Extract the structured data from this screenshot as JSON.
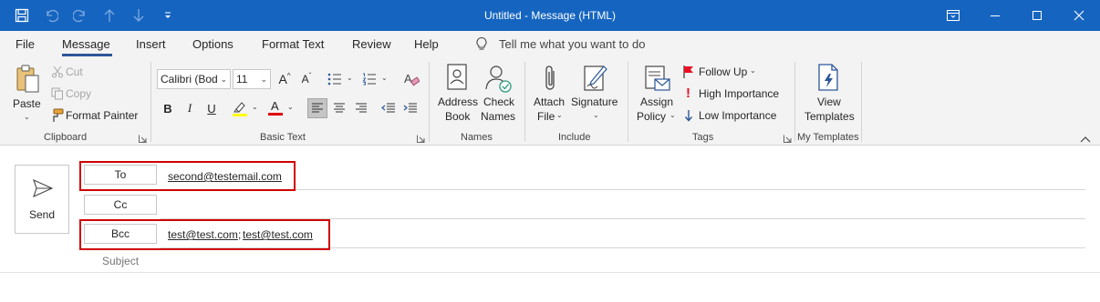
{
  "window": {
    "title": "Untitled  -  Message (HTML)"
  },
  "menu": {
    "tabs": [
      "File",
      "Message",
      "Insert",
      "Options",
      "Format Text",
      "Review",
      "Help"
    ],
    "active_tab": "Message",
    "tell_me": "Tell me what you want to do"
  },
  "ribbon": {
    "clipboard": {
      "paste": "Paste",
      "cut": "Cut",
      "copy": "Copy",
      "format_painter": "Format Painter",
      "group_label": "Clipboard"
    },
    "basic_text": {
      "font_name": "Calibri (Bod",
      "font_size": "11",
      "grow_font": "A",
      "shrink_font": "A",
      "bold": "B",
      "italic": "I",
      "underline": "U",
      "font_color_glyph": "A",
      "group_label": "Basic Text"
    },
    "names": {
      "address_book_line1": "Address",
      "address_book_line2": "Book",
      "check_names_line1": "Check",
      "check_names_line2": "Names",
      "group_label": "Names"
    },
    "include": {
      "attach_line1": "Attach",
      "attach_line2": "File",
      "signature": "Signature",
      "group_label": "Include"
    },
    "tags": {
      "assign_line1": "Assign",
      "assign_line2": "Policy",
      "follow_up": "Follow Up",
      "high_importance": "High Importance",
      "low_importance": "Low Importance",
      "group_label": "Tags"
    },
    "my_templates": {
      "view_line1": "View",
      "view_line2": "Templates",
      "group_label": "My Templates"
    }
  },
  "compose": {
    "send": "Send",
    "to_label": "To",
    "to_value": "second@testemail.com",
    "cc_label": "Cc",
    "bcc_label": "Bcc",
    "bcc_value_1": "test@test.com",
    "bcc_separator": ";",
    "bcc_value_2": "test@test.com",
    "subject_label": "Subject"
  },
  "colors": {
    "titlebar": "#1565c0",
    "ribbon_bg": "#f3f3f3",
    "active_tab_underline": "#2b579a",
    "highlight_box": "#d00000",
    "highlighter_yellow": "#ffff00",
    "font_color_red": "#e00000"
  }
}
